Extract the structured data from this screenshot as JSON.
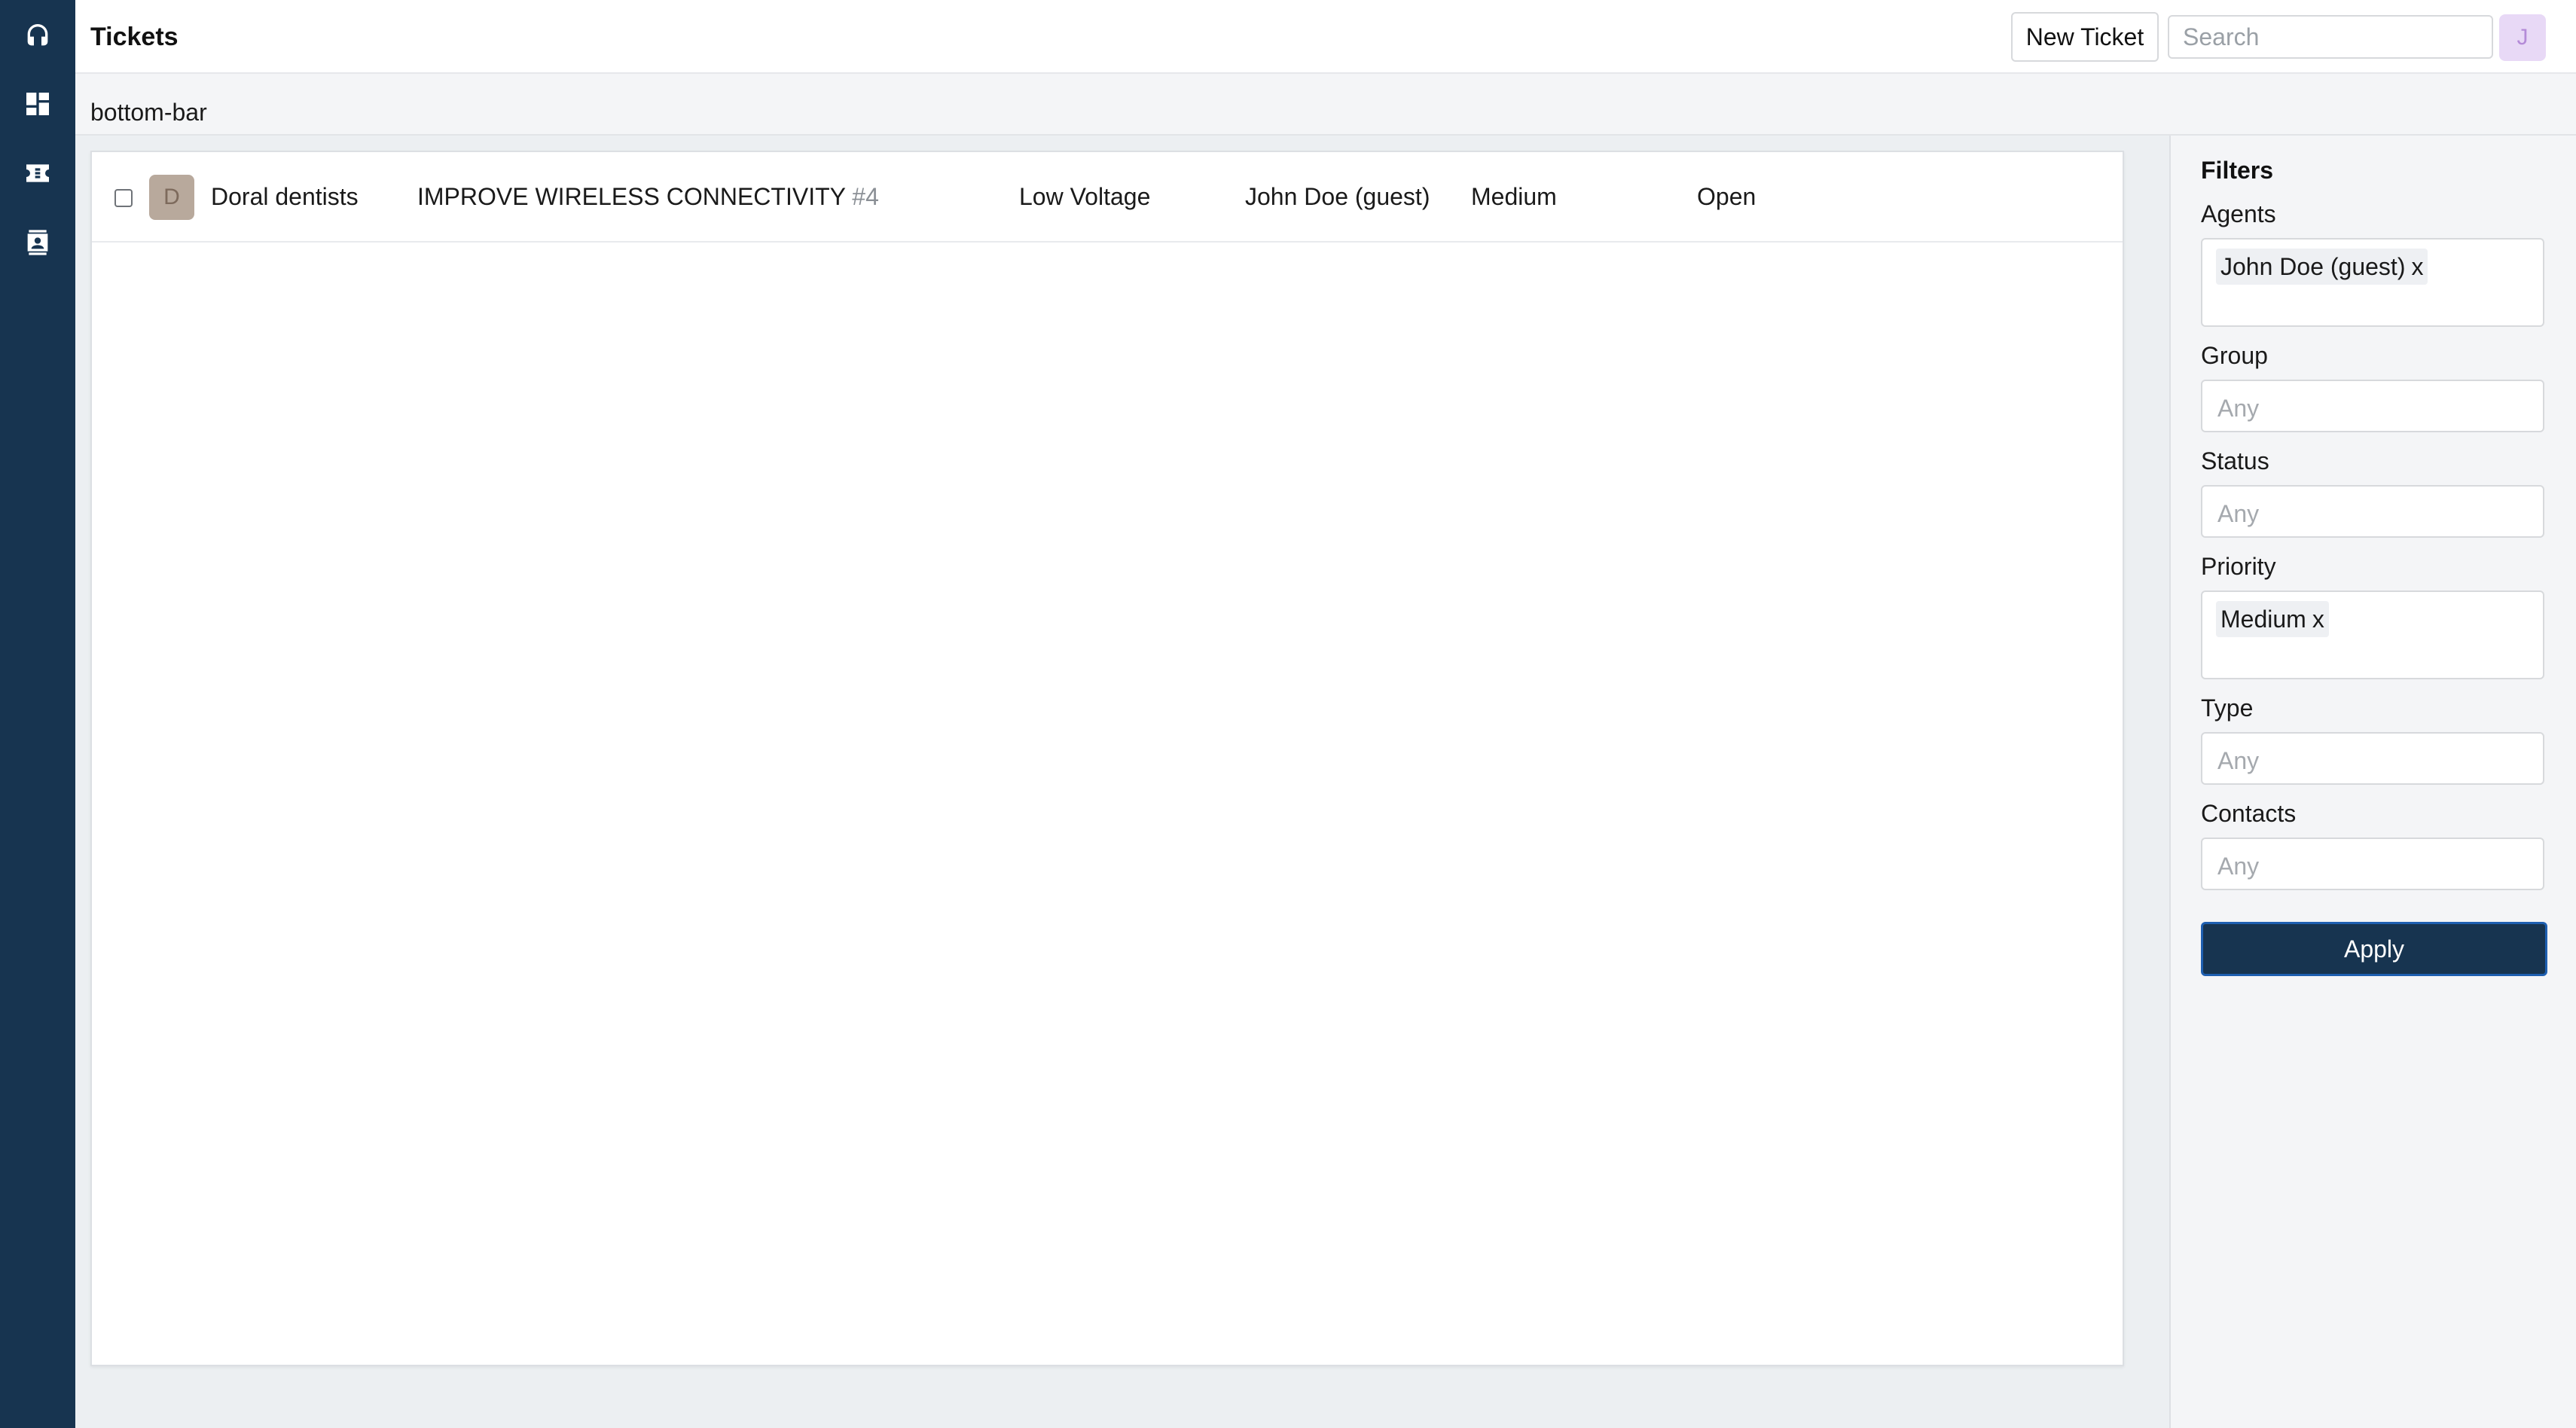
{
  "app": {
    "accent_color": "#173450",
    "sidebar_color": "#173450"
  },
  "sidebar": {
    "items": [
      {
        "icon": "headset-icon"
      },
      {
        "icon": "dashboard-icon"
      },
      {
        "icon": "ticket-icon"
      },
      {
        "icon": "contacts-icon"
      }
    ]
  },
  "header": {
    "title": "Tickets",
    "new_ticket_label": "New Ticket",
    "search_placeholder": "Search",
    "user_initial": "J"
  },
  "subbar": {
    "label": "bottom-bar"
  },
  "tickets": [
    {
      "contact_initial": "D",
      "contact": "Doral dentists",
      "subject": "IMPROVE WIRELESS CONNECTIVITY",
      "number": "#4",
      "group": "Low Voltage",
      "agent": "John Doe (guest)",
      "priority": "Medium",
      "status": "Open"
    }
  ],
  "filters": {
    "title": "Filters",
    "agents": {
      "label": "Agents",
      "chips": [
        "John Doe (guest)"
      ]
    },
    "group": {
      "label": "Group",
      "placeholder": "Any"
    },
    "status": {
      "label": "Status",
      "placeholder": "Any"
    },
    "priority": {
      "label": "Priority",
      "chips": [
        "Medium"
      ]
    },
    "type": {
      "label": "Type",
      "placeholder": "Any"
    },
    "contacts": {
      "label": "Contacts",
      "placeholder": "Any"
    },
    "chip_remove": "x",
    "apply_label": "Apply"
  }
}
